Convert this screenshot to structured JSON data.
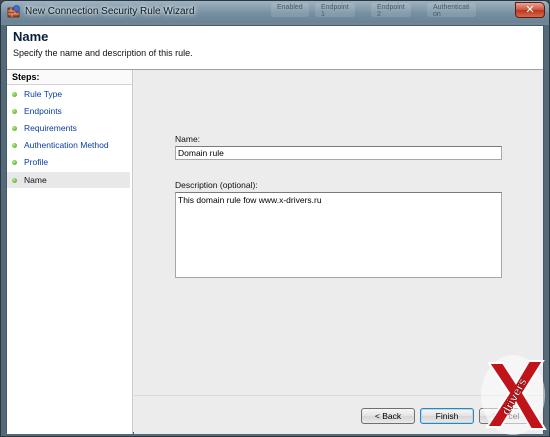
{
  "window": {
    "title": "New Connection Security Rule Wizard",
    "close_glyph": "✕",
    "background_tabs": [
      "Enabled",
      "Endpoint 1",
      "Endpoint 2",
      "Authenticati on"
    ]
  },
  "header": {
    "title": "Name",
    "subtitle": "Specify the name and description of this rule."
  },
  "steps": {
    "title": "Steps:",
    "items": [
      {
        "label": "Rule Type"
      },
      {
        "label": "Endpoints"
      },
      {
        "label": "Requirements"
      },
      {
        "label": "Authentication Method"
      },
      {
        "label": "Profile"
      },
      {
        "label": "Name",
        "current": true
      }
    ]
  },
  "form": {
    "name_label": "Name:",
    "name_value": "Domain rule",
    "description_label": "Description (optional):",
    "description_value": "This domain rule fow www.x-drivers.ru"
  },
  "buttons": {
    "back": "< Back",
    "finish": "Finish",
    "cancel": "Cancel"
  },
  "watermark": {
    "text": "drivers"
  },
  "colors": {
    "link_blue": "#0a3e9e",
    "step_dot_green": "#3c9a1c",
    "close_red": "#c8543c",
    "watermark_red": "#c0141a"
  },
  "icons": {
    "window": "shield-firewall-icon",
    "step": "green-dot-icon"
  }
}
